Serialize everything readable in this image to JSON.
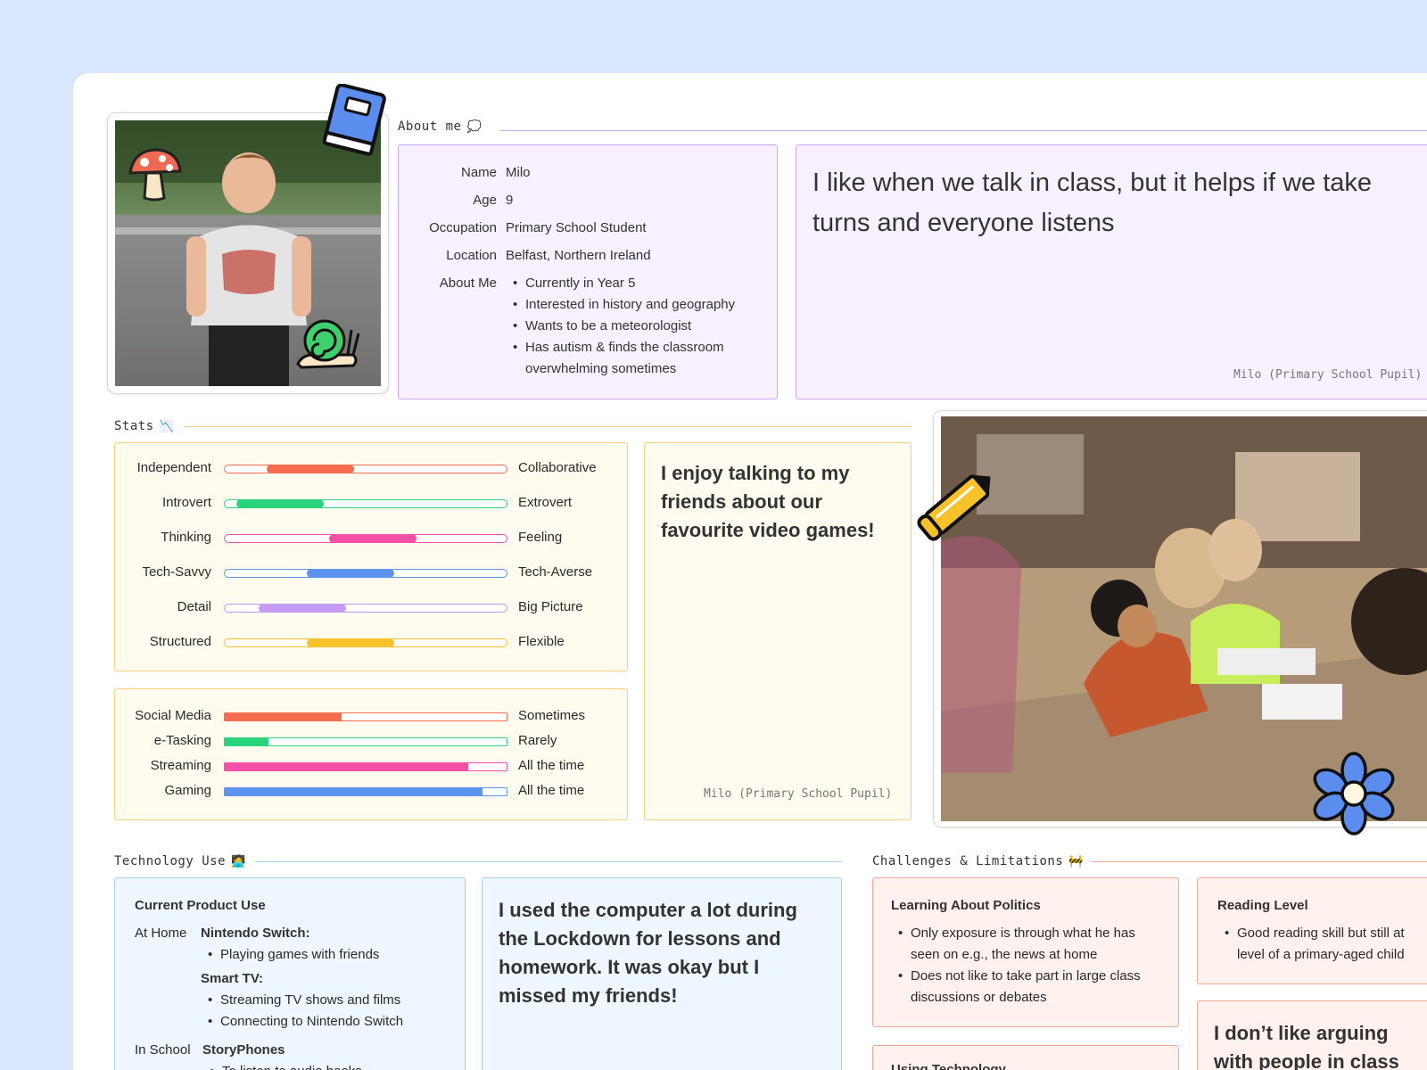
{
  "about": {
    "section_title": "About me",
    "section_icon": "thought-bubble-icon",
    "rows": [
      {
        "label": "Name",
        "value": "Milo"
      },
      {
        "label": "Age",
        "value": "9"
      },
      {
        "label": "Occupation",
        "value": "Primary School Student"
      },
      {
        "label": "Location",
        "value": "Belfast, Northern Ireland"
      }
    ],
    "about_me_label": "About Me",
    "about_me_items": [
      "Currently in Year 5",
      "Interested in history and geography",
      "Wants to be a meteorologist",
      "Has autism & finds the classroom overwhelming sometimes"
    ],
    "quote": "I like when we talk in class, but it helps if we take turns and everyone listens",
    "quote_attribution": "Milo (Primary School Pupil)"
  },
  "stats": {
    "section_title": "Stats",
    "section_icon": "chart-icon",
    "traits": [
      {
        "left": "Independent",
        "right": "Collaborative",
        "start": 0.15,
        "end": 0.46,
        "color": "#f66c4f"
      },
      {
        "left": "Introvert",
        "right": "Extrovert",
        "start": 0.04,
        "end": 0.35,
        "color": "#2bd37d"
      },
      {
        "left": "Thinking",
        "right": "Feeling",
        "start": 0.37,
        "end": 0.68,
        "color": "#f64fa6"
      },
      {
        "left": "Tech-Savvy",
        "right": "Tech-Averse",
        "start": 0.29,
        "end": 0.6,
        "color": "#5b93ee"
      },
      {
        "left": "Detail",
        "right": "Big Picture",
        "start": 0.12,
        "end": 0.43,
        "color": "#c39bf4"
      },
      {
        "left": "Structured",
        "right": "Flexible",
        "start": 0.29,
        "end": 0.6,
        "color": "#f7c129"
      }
    ],
    "usage": [
      {
        "label": "Social Media",
        "value": "Sometimes",
        "level": 0.42,
        "color": "#f66c4f"
      },
      {
        "label": "e-Tasking",
        "value": "Rarely",
        "level": 0.16,
        "color": "#2bd37d"
      },
      {
        "label": "Streaming",
        "value": "All the time",
        "level": 0.87,
        "color": "#f64fa6"
      },
      {
        "label": "Gaming",
        "value": "All the time",
        "level": 0.92,
        "color": "#5b93ee"
      }
    ],
    "quote": "I enjoy talking to my friends about our favourite video games!",
    "quote_attribution": "Milo (Primary School Pupil)"
  },
  "technology": {
    "section_title": "Technology Use",
    "section_icon": "computer-user-icon",
    "current_title": "Current Product Use",
    "home_label": "At Home",
    "home_products": [
      {
        "name": "Nintendo Switch:",
        "items": [
          "Playing games with friends"
        ]
      },
      {
        "name": "Smart TV:",
        "items": [
          "Streaming TV shows and films",
          "Connecting to Nintendo Switch"
        ]
      }
    ],
    "school_label": "In School",
    "school_product": "StoryPhones",
    "school_item": "To listen to audio books",
    "quote": "I used the computer a lot during the Lockdown for lessons and homework. It was okay but I missed my friends!"
  },
  "challenges": {
    "section_title": "Challenges & Limitations",
    "section_icon": "construction-barrier-icon",
    "politics_title": "Learning About Politics",
    "politics_items": [
      "Only exposure is through what he has seen on e.g., the news at home",
      "Does not like to take part in large class discussions or debates"
    ],
    "reading_title": "Reading Level",
    "reading_items": [
      "Good reading skill but still at level of a primary-aged child"
    ],
    "technology_title": "Using Technology",
    "quote": "I don’t like arguing with people in class"
  }
}
